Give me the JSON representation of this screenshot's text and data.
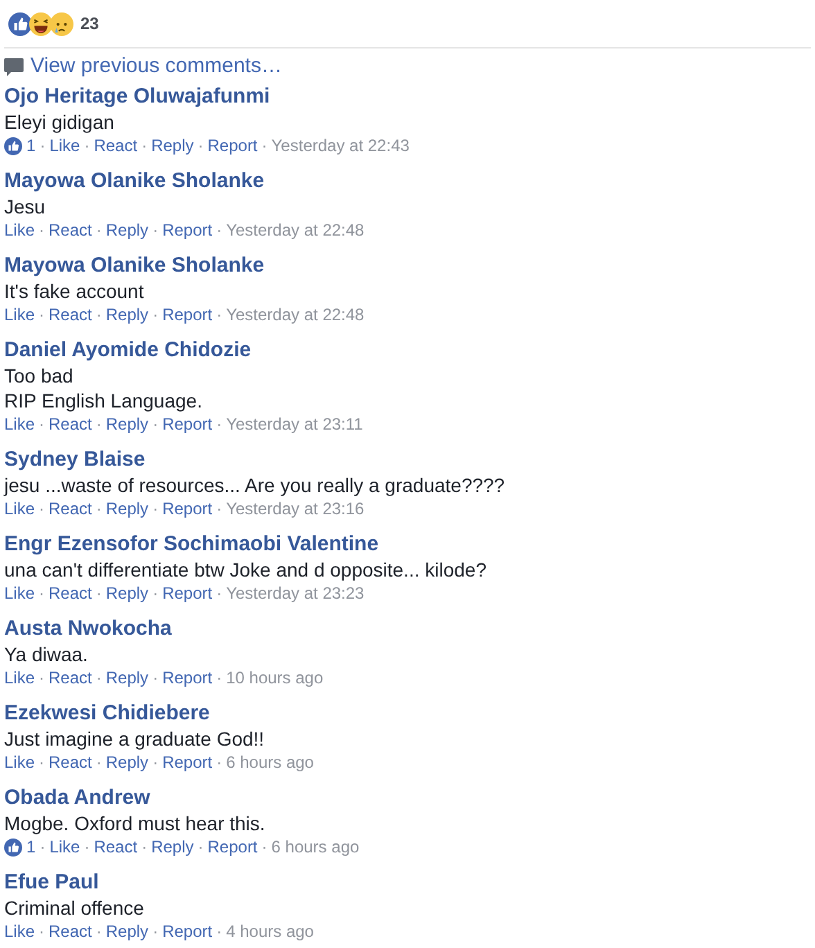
{
  "reactions": {
    "count": "23"
  },
  "view_previous": "View previous comments…",
  "separator": "·",
  "comments": [
    {
      "author": "Ojo Heritage Oluwajafunmi",
      "lines": [
        "Eleyi gidigan"
      ],
      "likes": "1",
      "actions": [
        "Like",
        "React",
        "Reply",
        "Report"
      ],
      "time": "Yesterday at 22:43"
    },
    {
      "author": "Mayowa Olanike Sholanke",
      "lines": [
        "Jesu"
      ],
      "actions": [
        "Like",
        "React",
        "Reply",
        "Report"
      ],
      "time": "Yesterday at 22:48"
    },
    {
      "author": "Mayowa Olanike Sholanke",
      "lines": [
        "It's fake account"
      ],
      "actions": [
        "Like",
        "React",
        "Reply",
        "Report"
      ],
      "time": "Yesterday at 22:48"
    },
    {
      "author": "Daniel Ayomide Chidozie",
      "lines": [
        "Too bad",
        "RIP English Language."
      ],
      "actions": [
        "Like",
        "React",
        "Reply",
        "Report"
      ],
      "time": "Yesterday at 23:11"
    },
    {
      "author": "Sydney Blaise",
      "lines": [
        "jesu ...waste of resources... Are you really a graduate????"
      ],
      "actions": [
        "Like",
        "React",
        "Reply",
        "Report"
      ],
      "time": "Yesterday at 23:16"
    },
    {
      "author": "Engr Ezensofor Sochimaobi Valentine",
      "lines": [
        "una can't differentiate btw Joke and d opposite... kilode?"
      ],
      "actions": [
        "Like",
        "React",
        "Reply",
        "Report"
      ],
      "time": "Yesterday at 23:23"
    },
    {
      "author": "Austa Nwokocha",
      "lines": [
        "Ya diwaa."
      ],
      "actions": [
        "Like",
        "React",
        "Reply",
        "Report"
      ],
      "time": "10 hours ago"
    },
    {
      "author": "Ezekwesi Chidiebere",
      "lines": [
        "Just imagine a graduate God!!"
      ],
      "actions": [
        "Like",
        "React",
        "Reply",
        "Report"
      ],
      "time": "6 hours ago"
    },
    {
      "author": "Obada Andrew",
      "lines": [
        "Mogbe. Oxford must hear this."
      ],
      "likes": "1",
      "actions": [
        "Like",
        "React",
        "Reply",
        "Report"
      ],
      "time": "6 hours ago"
    },
    {
      "author": "Efue Paul",
      "lines": [
        "Criminal offence"
      ],
      "actions": [
        "Like",
        "React",
        "Reply",
        "Report"
      ],
      "time": "4 hours ago"
    }
  ]
}
